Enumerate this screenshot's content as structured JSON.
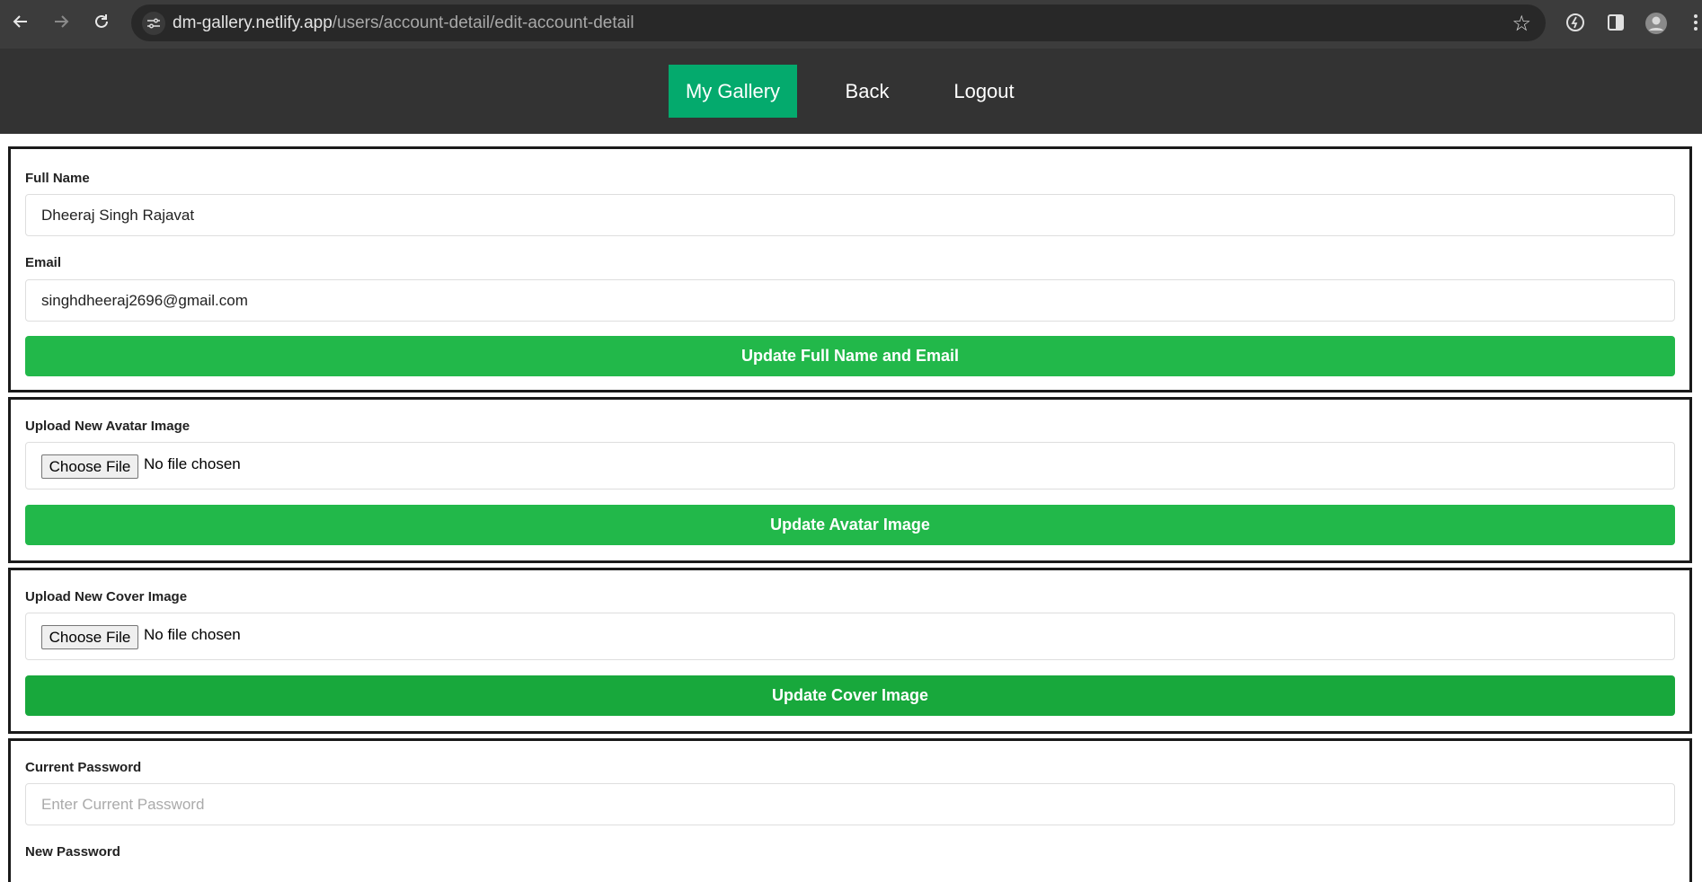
{
  "browser": {
    "url_host": "dm-gallery.netlify.app",
    "url_path": "/users/account-detail/edit-account-detail"
  },
  "header": {
    "nav": [
      {
        "label": "My Gallery",
        "active": true
      },
      {
        "label": "Back"
      },
      {
        "label": "Logout"
      }
    ]
  },
  "profile_form": {
    "full_name_label": "Full Name",
    "full_name_value": "Dheeraj Singh Rajavat",
    "email_label": "Email",
    "email_value": "singhdheeraj2696@gmail.com",
    "submit_label": "Update Full Name and Email"
  },
  "avatar_form": {
    "label": "Upload New Avatar Image",
    "choose_label": "Choose File",
    "no_file_text": "No file chosen",
    "submit_label": "Update Avatar Image"
  },
  "cover_form": {
    "label": "Upload New Cover Image",
    "choose_label": "Choose File",
    "no_file_text": "No file chosen",
    "submit_label": "Update Cover Image"
  },
  "password_form": {
    "current_label": "Current Password",
    "current_placeholder": "Enter Current Password",
    "new_label": "New Password"
  },
  "colors": {
    "header_bg": "#333333",
    "nav_active": "#04aa6d",
    "button_green": "#22b84a",
    "button_green_dark": "#18a83c"
  }
}
